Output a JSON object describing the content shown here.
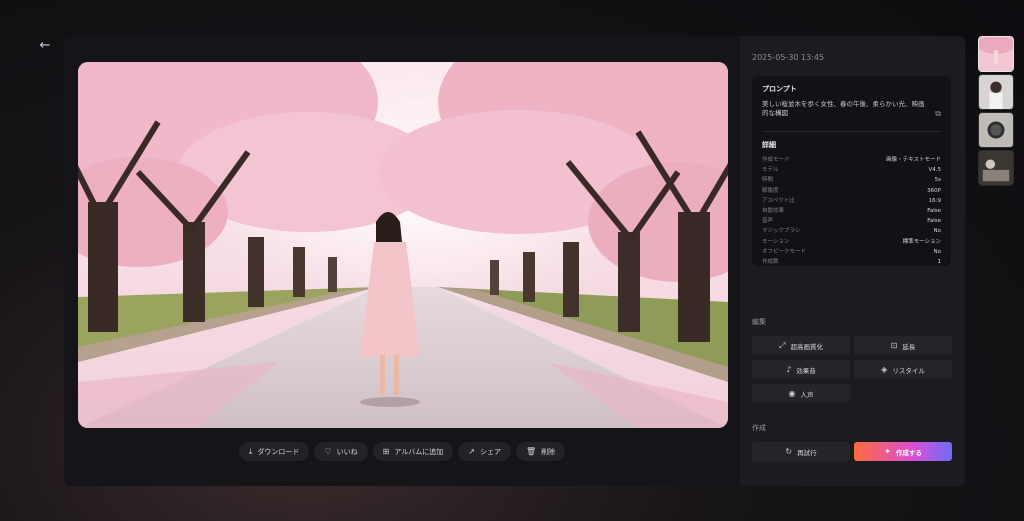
{
  "timestamp": "2025-05-30 13:45",
  "prompt": {
    "heading": "プロンプト",
    "text": "美しい桜並木を歩く女性、春の午後、柔らかい光、映画的な構図"
  },
  "details": {
    "heading": "詳細",
    "rows": [
      {
        "key": "作成モード",
        "value": "画像・テキストモード"
      },
      {
        "key": "モデル",
        "value": "V4.5"
      },
      {
        "key": "時間",
        "value": "5s"
      },
      {
        "key": "解像度",
        "value": "360P"
      },
      {
        "key": "アスペクト比",
        "value": "16:9"
      },
      {
        "key": "自動効果",
        "value": "False"
      },
      {
        "key": "音声",
        "value": "False"
      },
      {
        "key": "マジックブラシ",
        "value": "No"
      },
      {
        "key": "モーション",
        "value": "標準モーション"
      },
      {
        "key": "オフピークモード",
        "value": "No"
      },
      {
        "key": "作成数",
        "value": "1"
      }
    ]
  },
  "edit": {
    "label": "編集",
    "buttons": [
      "超高画質化",
      "延長",
      "効果音",
      "リスタイル",
      "人声"
    ]
  },
  "create": {
    "label": "作成",
    "retry": "再試行",
    "create": "作成する"
  },
  "actions": [
    "ダウンロード",
    "いいね",
    "アルバムに追加",
    "シェア",
    "削除"
  ]
}
